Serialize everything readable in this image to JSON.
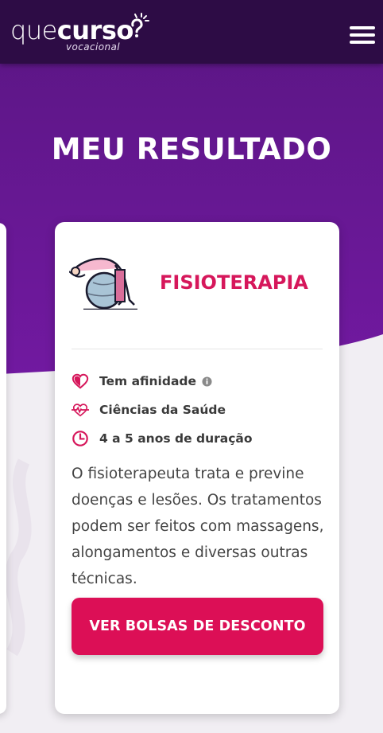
{
  "header": {
    "logo_prefix": "que",
    "logo_main": "curso",
    "logo_sub": "vocacional",
    "menu_icon": "hamburger-menu-icon"
  },
  "hero": {
    "title": "MEU RESULTADO"
  },
  "result_card": {
    "course": "FISIOTERAPIA",
    "illustration": "person-stretching-on-exercise-ball",
    "info": [
      {
        "icon": "heart-icon",
        "text": "Tem afinidade",
        "has_info_icon": true
      },
      {
        "icon": "heartbeat-icon",
        "text": "Ciências da Saúde"
      },
      {
        "icon": "clock-icon",
        "text": "4 a 5 anos de duração"
      }
    ],
    "description": "O fisioterapeuta trata e previne doenças e lesões. Os tratamentos podem ser feitos com massagens, alongamentos e diversas outras técnicas.",
    "cta_label": "VER BOLSAS DE DESCONTO"
  },
  "colors": {
    "header_bg": "#2d0c45",
    "hero_purple": "#6a1a8f",
    "accent": "#d6175b",
    "button": "#dc0f56"
  }
}
